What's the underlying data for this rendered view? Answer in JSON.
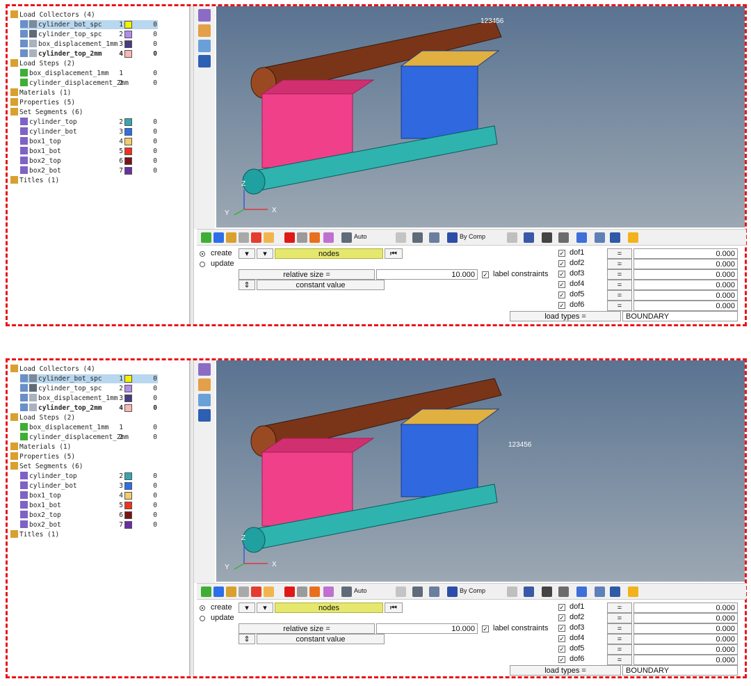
{
  "tree": {
    "load_collectors": "Load Collectors (4)",
    "collectors": [
      {
        "name": "cylinder_bot_spc",
        "id": "1",
        "color": "#f5ef00",
        "zero": "0"
      },
      {
        "name": "cylinder_top_spc",
        "id": "2",
        "color": "#b18ce8",
        "zero": "0"
      },
      {
        "name": "box_displacement_1mm",
        "id": "3",
        "color": "#4a3a86",
        "zero": "0"
      },
      {
        "name": "cylinder_top_2mm",
        "id": "4",
        "color": "#f7b8b5",
        "zero": "0"
      }
    ],
    "load_steps": "Load Steps (2)",
    "steps": [
      {
        "name": "box_displacement_1mm",
        "id": "1",
        "zero": "0"
      },
      {
        "name": "cylinder_displacement_2mm",
        "id": "2",
        "zero": "0"
      }
    ],
    "materials": "Materials (1)",
    "properties": "Properties (5)",
    "set_segments": "Set Segments (6)",
    "segments": [
      {
        "name": "cylinder_top",
        "id": "2",
        "color": "#35a7b0",
        "zero": "0"
      },
      {
        "name": "cylinder_bot",
        "id": "3",
        "color": "#2d6fe8",
        "zero": "0"
      },
      {
        "name": "box1_top",
        "id": "4",
        "color": "#f1cc6a",
        "zero": "0"
      },
      {
        "name": "box1_bot",
        "id": "5",
        "color": "#f2301e",
        "zero": "0"
      },
      {
        "name": "box2_top",
        "id": "6",
        "color": "#7a1414",
        "zero": "0"
      },
      {
        "name": "box2_bot",
        "id": "7",
        "color": "#6a2ea5",
        "zero": "0"
      }
    ],
    "titles": "Titles (1)"
  },
  "viewport": {
    "axis_z": "Z",
    "axis_y": "Y",
    "axis_x": "X",
    "dof_label_panel1": "123456",
    "dof_label_panel2": "123456"
  },
  "toolbar": {
    "auto": "Auto",
    "by_comp": "By Comp"
  },
  "form": {
    "create": "create",
    "update": "update",
    "nodes": "nodes",
    "relative_size_label": "relative size =",
    "relative_size_value": "10.000",
    "label_constraints": "label constraints",
    "constant_value": "constant value",
    "equals": "=",
    "dofs": [
      {
        "label": "dof1",
        "value": "0.000"
      },
      {
        "label": "dof2",
        "value": "0.000"
      },
      {
        "label": "dof3",
        "value": "0.000"
      },
      {
        "label": "dof4",
        "value": "0.000"
      },
      {
        "label": "dof5",
        "value": "0.000"
      },
      {
        "label": "dof6",
        "value": "0.000"
      }
    ],
    "load_types_label": "load types =",
    "load_types_value": "BOUNDARY"
  }
}
